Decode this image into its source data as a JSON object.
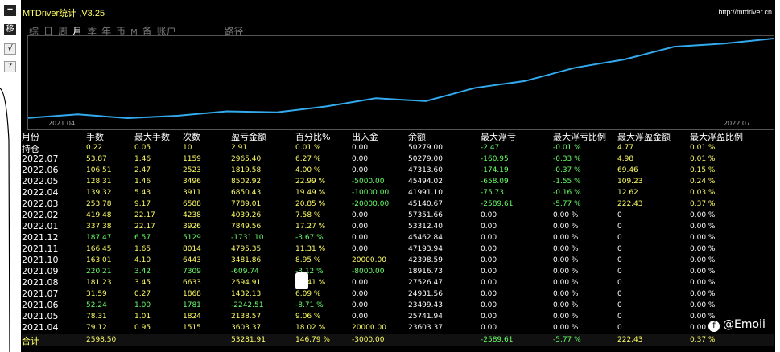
{
  "app": {
    "title": "MTDriver统计 ,V3.25",
    "url": "http://mtdriver.cn"
  },
  "toolbar": {
    "buttons": [
      {
        "name": "minimize-button",
        "label": "━"
      },
      {
        "name": "move-button",
        "label": "移"
      },
      {
        "name": "check-button",
        "label": "√"
      },
      {
        "name": "help-button",
        "label": "?"
      }
    ]
  },
  "tabs": [
    {
      "label": "综",
      "active": false
    },
    {
      "label": "日",
      "active": false
    },
    {
      "label": "周",
      "active": false
    },
    {
      "label": "月",
      "active": true
    },
    {
      "label": "季",
      "active": false
    },
    {
      "label": "年",
      "active": false
    },
    {
      "label": "币",
      "active": false
    },
    {
      "label": "M",
      "active": false
    },
    {
      "label": "备",
      "active": false
    },
    {
      "label": "账户",
      "active": false
    },
    {
      "label": "路径",
      "active": false
    }
  ],
  "chart_data": {
    "type": "line",
    "x_start_label": "2021.04",
    "x_end_label": "2022.07",
    "x": [
      "2021.04",
      "2021.05",
      "2021.06",
      "2021.07",
      "2021.08",
      "2021.09",
      "2021.10",
      "2021.11",
      "2021.12",
      "2022.01",
      "2022.02",
      "2022.03",
      "2022.04",
      "2022.05",
      "2022.06",
      "2022.07"
    ],
    "values": [
      3603.37,
      5741.74,
      3499.23,
      4931.56,
      7526.47,
      6916.73,
      10398.59,
      15193.94,
      13462.54,
      21312.4,
      25351.66,
      33140.67,
      37991.1,
      45494.02,
      47313.6,
      50279.0
    ],
    "line_color": "#33aaee"
  },
  "table": {
    "headers": [
      "月份",
      "手数",
      "最大手数",
      "次数",
      "盈亏金额",
      "百分比%",
      "出入金",
      "余额",
      "最大浮亏",
      "最大浮亏比例",
      "最大浮盈金额",
      "最大浮盈比例"
    ],
    "rows": [
      {
        "label": "持仓",
        "cells": [
          "0.22",
          "0.05",
          "10",
          "2.91",
          "0.01 %",
          "0.00",
          "50279.00",
          "-2.47",
          "-0.01 %",
          "4.77",
          "0.01 %"
        ],
        "colors": [
          "y",
          "y",
          "y",
          "y",
          "y",
          "w",
          "w",
          "g",
          "g",
          "y",
          "y"
        ]
      },
      {
        "label": "2022.07",
        "cells": [
          "53.87",
          "1.46",
          "1159",
          "2965.40",
          "6.27 %",
          "0.00",
          "50279.00",
          "-160.95",
          "-0.33 %",
          "4.98",
          "0.01 %"
        ],
        "colors": [
          "y",
          "y",
          "y",
          "y",
          "y",
          "w",
          "w",
          "g",
          "g",
          "y",
          "y"
        ]
      },
      {
        "label": "2022.06",
        "cells": [
          "106.51",
          "2.47",
          "2523",
          "1819.58",
          "4.00 %",
          "0.00",
          "47313.60",
          "-174.19",
          "-0.37 %",
          "69.46",
          "0.15 %"
        ],
        "colors": [
          "y",
          "y",
          "y",
          "y",
          "y",
          "w",
          "w",
          "g",
          "g",
          "y",
          "y"
        ]
      },
      {
        "label": "2022.05",
        "cells": [
          "128.31",
          "1.46",
          "3496",
          "8502.92",
          "22.99 %",
          "-5000.00",
          "45494.02",
          "-658.09",
          "-1.55 %",
          "109.23",
          "0.24 %"
        ],
        "colors": [
          "y",
          "y",
          "y",
          "y",
          "y",
          "g",
          "w",
          "g",
          "g",
          "y",
          "y"
        ]
      },
      {
        "label": "2022.04",
        "cells": [
          "139.32",
          "5.43",
          "3911",
          "6850.43",
          "19.49 %",
          "-10000.00",
          "41991.10",
          "-75.73",
          "-0.16 %",
          "12.62",
          "0.03 %"
        ],
        "colors": [
          "y",
          "y",
          "y",
          "y",
          "y",
          "g",
          "w",
          "g",
          "g",
          "y",
          "y"
        ]
      },
      {
        "label": "2022.03",
        "cells": [
          "253.78",
          "9.17",
          "6588",
          "7789.01",
          "20.85 %",
          "-20000.00",
          "45140.67",
          "-2589.61",
          "-5.77 %",
          "222.43",
          "0.37 %"
        ],
        "colors": [
          "y",
          "y",
          "y",
          "y",
          "y",
          "g",
          "w",
          "g",
          "g",
          "y",
          "y"
        ]
      },
      {
        "label": "2022.02",
        "cells": [
          "419.48",
          "22.17",
          "4238",
          "4039.26",
          "7.58 %",
          "0.00",
          "57351.66",
          "0.00",
          "0.00 %",
          "0",
          "0.00 %"
        ],
        "colors": [
          "y",
          "y",
          "y",
          "y",
          "y",
          "w",
          "w",
          "w",
          "w",
          "w",
          "w"
        ]
      },
      {
        "label": "2022.01",
        "cells": [
          "337.38",
          "22.17",
          "3926",
          "7849.56",
          "17.27 %",
          "0.00",
          "53312.40",
          "0.00",
          "0.00 %",
          "0",
          "0.00 %"
        ],
        "colors": [
          "y",
          "y",
          "y",
          "y",
          "y",
          "w",
          "w",
          "w",
          "w",
          "w",
          "w"
        ]
      },
      {
        "label": "2021.12",
        "cells": [
          "187.47",
          "6.57",
          "5129",
          "-1731.10",
          "-3.67 %",
          "0.00",
          "45462.84",
          "0.00",
          "0.00 %",
          "0",
          "0.00 %"
        ],
        "colors": [
          "g",
          "g",
          "g",
          "g",
          "g",
          "w",
          "w",
          "w",
          "w",
          "w",
          "w"
        ]
      },
      {
        "label": "2021.11",
        "cells": [
          "166.45",
          "1.65",
          "8014",
          "4795.35",
          "11.31 %",
          "0.00",
          "47193.94",
          "0.00",
          "0.00 %",
          "0",
          "0.00 %"
        ],
        "colors": [
          "y",
          "y",
          "y",
          "y",
          "y",
          "w",
          "w",
          "w",
          "w",
          "w",
          "w"
        ]
      },
      {
        "label": "2021.10",
        "cells": [
          "163.01",
          "4.10",
          "6443",
          "3481.86",
          "8.95 %",
          "20000.00",
          "42398.59",
          "0.00",
          "0.00 %",
          "0",
          "0.00 %"
        ],
        "colors": [
          "y",
          "y",
          "y",
          "y",
          "y",
          "y",
          "w",
          "w",
          "w",
          "w",
          "w"
        ]
      },
      {
        "label": "2021.09",
        "cells": [
          "220.21",
          "3.42",
          "7309",
          "-609.74",
          "-3.12 %",
          "-8000.00",
          "18916.73",
          "0.00",
          "0.00 %",
          "0",
          "0.00 %"
        ],
        "colors": [
          "g",
          "g",
          "g",
          "g",
          "g",
          "g",
          "w",
          "w",
          "w",
          "w",
          "w"
        ]
      },
      {
        "label": "2021.08",
        "cells": [
          "181.23",
          "3.45",
          "6633",
          "2594.91",
          "10.41 %",
          "0.00",
          "27526.47",
          "0.00",
          "0.00 %",
          "0",
          "0.00 %"
        ],
        "colors": [
          "y",
          "y",
          "y",
          "y",
          "y",
          "w",
          "w",
          "w",
          "w",
          "w",
          "w"
        ]
      },
      {
        "label": "2021.07",
        "cells": [
          "31.59",
          "0.27",
          "1868",
          "1432.13",
          "6.09 %",
          "0.00",
          "24931.56",
          "0.00",
          "0.00 %",
          "0",
          "0.00 %"
        ],
        "colors": [
          "y",
          "y",
          "y",
          "y",
          "y",
          "w",
          "w",
          "w",
          "w",
          "w",
          "w"
        ]
      },
      {
        "label": "2021.06",
        "cells": [
          "52.24",
          "1.00",
          "1781",
          "-2242.51",
          "-8.71 %",
          "0.00",
          "23499.43",
          "0.00",
          "0.00 %",
          "0",
          "0.00 %"
        ],
        "colors": [
          "g",
          "g",
          "g",
          "g",
          "g",
          "w",
          "w",
          "w",
          "w",
          "w",
          "w"
        ]
      },
      {
        "label": "2021.05",
        "cells": [
          "78.31",
          "1.01",
          "1824",
          "2138.57",
          "9.06 %",
          "0.00",
          "25741.94",
          "0.00",
          "0.00 %",
          "0",
          "0.00 %"
        ],
        "colors": [
          "y",
          "y",
          "y",
          "y",
          "y",
          "w",
          "w",
          "w",
          "w",
          "w",
          "w"
        ]
      },
      {
        "label": "2021.04",
        "cells": [
          "79.12",
          "0.95",
          "1515",
          "3603.37",
          "18.02 %",
          "20000.00",
          "23603.37",
          "0.00",
          "0.00 %",
          "0",
          "0.00 %"
        ],
        "colors": [
          "y",
          "y",
          "y",
          "y",
          "y",
          "y",
          "w",
          "w",
          "w",
          "w",
          "w"
        ]
      }
    ],
    "total": {
      "label": "合计",
      "cells": [
        "2598.50",
        "",
        "",
        "53281.91",
        "146.79 %",
        "-3000.00",
        "",
        "-2589.61",
        "-5.77 %",
        "222.43",
        "0.37 %"
      ],
      "colors": [
        "y",
        "y",
        "y",
        "y",
        "y",
        "y",
        "w",
        "g",
        "g",
        "y",
        "y"
      ]
    }
  },
  "watermark": {
    "text": "@Emoii"
  },
  "colors": {
    "yellow": "#ffff66",
    "green": "#66ff66",
    "white": "#ffffff",
    "background": "#000000"
  }
}
